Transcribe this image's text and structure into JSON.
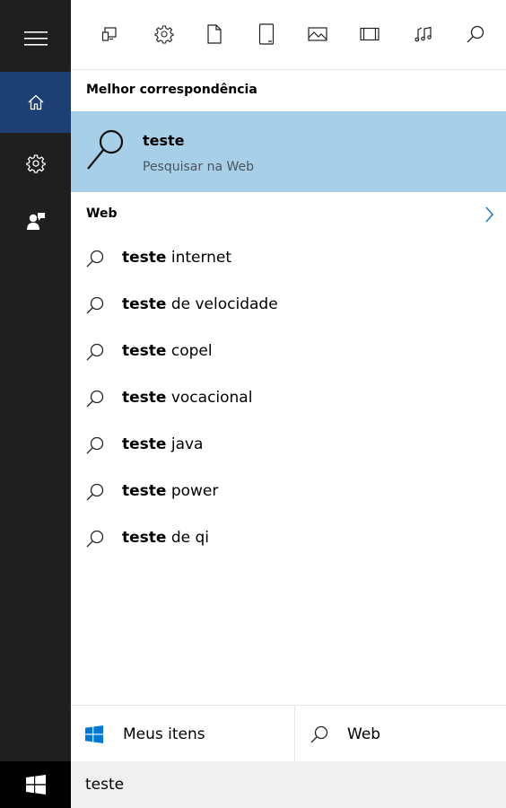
{
  "toolbar": {
    "filters": [
      "apps-icon",
      "settings-icon",
      "documents-icon",
      "tablet-icon",
      "photos-icon",
      "videos-icon",
      "music-icon",
      "search-icon"
    ]
  },
  "sidebar": {
    "items": [
      "hamburger-menu-icon",
      "home-icon",
      "settings-icon",
      "feedback-icon"
    ]
  },
  "best_match": {
    "header": "Melhor correspondência",
    "title": "teste",
    "subtitle": "Pesquisar na Web"
  },
  "web": {
    "header": "Web",
    "suggestions": [
      {
        "bold": "teste",
        "rest": " internet"
      },
      {
        "bold": "teste",
        "rest": " de velocidade"
      },
      {
        "bold": "teste",
        "rest": " copel"
      },
      {
        "bold": "teste",
        "rest": " vocacional"
      },
      {
        "bold": "teste",
        "rest": " java"
      },
      {
        "bold": "teste",
        "rest": " power"
      },
      {
        "bold": "teste",
        "rest": " de qi"
      }
    ]
  },
  "scope": {
    "my_items": "Meus itens",
    "web": "Web"
  },
  "search": {
    "value": "teste"
  },
  "colors": {
    "rail": "#1f1f1f",
    "rail_active": "#1e3f73",
    "highlight": "#a8cfe8",
    "accent": "#0078d7"
  }
}
